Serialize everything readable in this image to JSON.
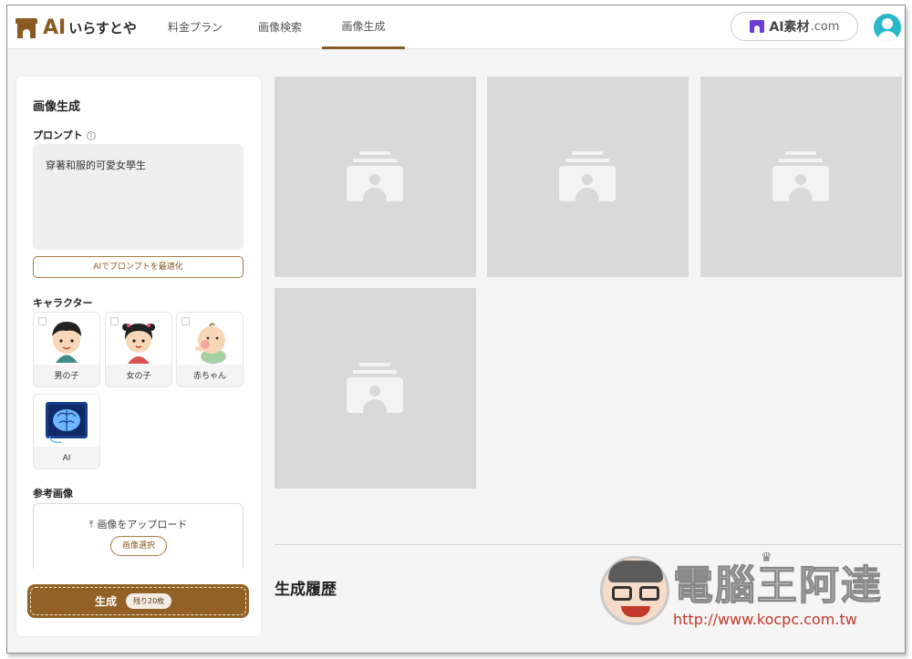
{
  "header": {
    "logo_ai": "AI",
    "logo_text": "いらすとや",
    "tabs": [
      {
        "label": "料金プラン",
        "active": false
      },
      {
        "label": "画像検索",
        "active": false
      },
      {
        "label": "画像生成",
        "active": true
      }
    ],
    "partner_main": "AI素材",
    "partner_domain": ".com",
    "avatar_icon": "user-avatar-icon"
  },
  "panel": {
    "title": "画像生成",
    "prompt_label": "プロンプト",
    "prompt_help_glyph": "?",
    "prompt_value": "穿著和服的可愛女學生",
    "optimize_label": "AIでプロンプトを最適化",
    "character_label": "キャラクター",
    "characters": [
      {
        "name": "男の子",
        "icon": "boy-character-icon"
      },
      {
        "name": "女の子",
        "icon": "girl-character-icon"
      },
      {
        "name": "赤ちゃん",
        "icon": "baby-character-icon"
      },
      {
        "name": "AI",
        "icon": "ai-brain-icon"
      }
    ],
    "reference_label": "参考画像",
    "upload_glyph": "⤒",
    "upload_label": "画像をアップロード",
    "select_label": "画像選択",
    "generate_label": "生成",
    "remaining_label": "残り20枚"
  },
  "main": {
    "placeholder_count": 4,
    "history_title": "生成履歴"
  },
  "watermark": {
    "crown_glyph": "♛",
    "title": "電腦王阿達",
    "url": "http://www.kocpc.com.tw"
  },
  "colors": {
    "brand": "#8a5a22",
    "generate_button": "#936127",
    "partner_icon": "#6d3bd6",
    "avatar": "#29b8c7",
    "placeholder": "#d9d9d9"
  }
}
